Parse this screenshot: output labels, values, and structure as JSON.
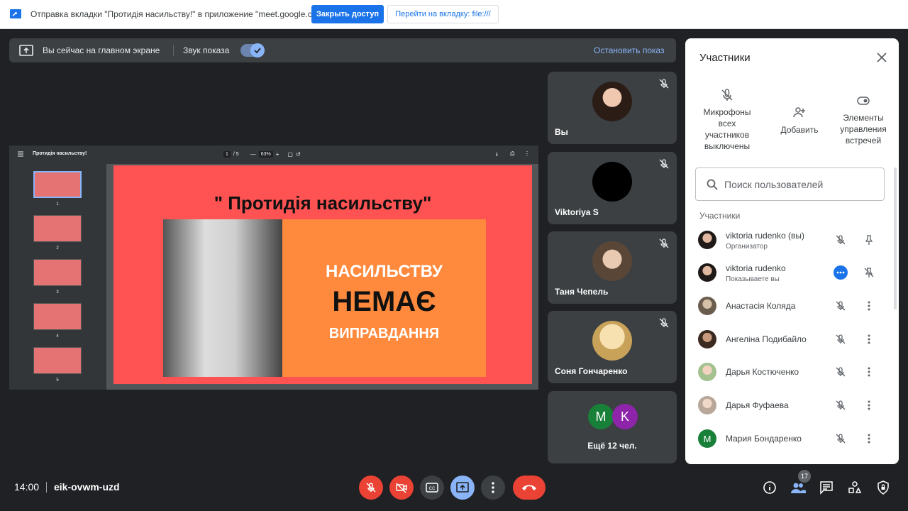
{
  "sharing_bar": {
    "text": "Отправка вкладки \"Протидія насильству!\" в приложение \"meet.google.com\"...",
    "stop_access": "Закрыть доступ",
    "go_to_tab": "Перейти на вкладку: file:///"
  },
  "presenting_bar": {
    "text": "Вы сейчас на главном экране",
    "audio_label": "Звук показа",
    "stop_label": "Остановить показ"
  },
  "pdf_viewer": {
    "title": "Протидія насильству!",
    "page_current": "1",
    "page_total": "/ 5",
    "zoom": "63%",
    "thumbnails": [
      "1",
      "2",
      "3",
      "4",
      "5"
    ],
    "slide": {
      "title": "\" Протидія насильству\"",
      "line1": "НАСИЛЬСТВУ",
      "line2": "НЕМАЄ",
      "line3": "ВИПРАВДАННЯ"
    }
  },
  "tiles": [
    {
      "name": "Вы"
    },
    {
      "name": "Viktoriya S"
    },
    {
      "name": "Таня Чепель"
    },
    {
      "name": "Соня Гончаренко"
    }
  ],
  "more_tile": {
    "avatars": [
      "M",
      "K"
    ],
    "label": "Ещё 12 чел."
  },
  "panel": {
    "title": "Участники",
    "actions": [
      {
        "label": "Микрофоны всех участников выключены"
      },
      {
        "label": "Добавить"
      },
      {
        "label": "Элементы управления встречей"
      }
    ],
    "search_placeholder": "Поиск пользователей",
    "section_label": "Участники",
    "participants": [
      {
        "name": "viktoria rudenko (вы)",
        "sub": "Организатор"
      },
      {
        "name": "viktoria rudenko",
        "sub": "Показываете вы"
      },
      {
        "name": "Анастасія Коляда"
      },
      {
        "name": "Ангеліна Подибайло"
      },
      {
        "name": "Дарья Костюченко"
      },
      {
        "name": "Дарья Фуфаева"
      },
      {
        "name": "Мария Бондаренко",
        "initial": "M"
      }
    ]
  },
  "bottom_bar": {
    "time": "14:00",
    "meeting_code": "eik-ovwm-uzd",
    "participants_count": "17"
  },
  "colors": {
    "accent": "#8ab4f8",
    "danger": "#ea4335",
    "background": "#202124",
    "tile": "#3c4043"
  }
}
